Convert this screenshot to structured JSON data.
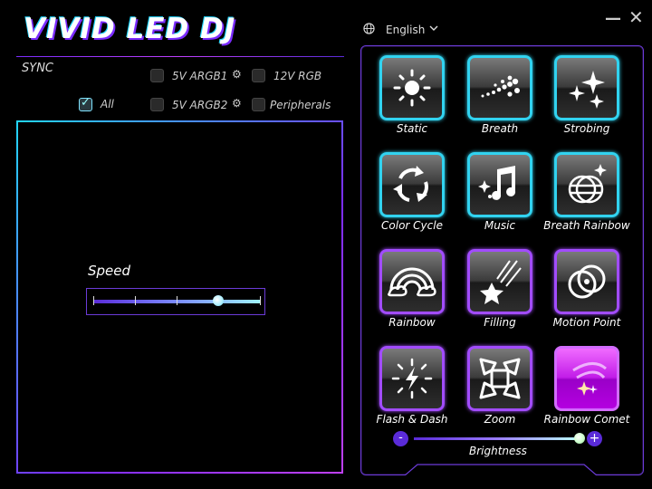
{
  "app": {
    "title": "VIVID LED DJ"
  },
  "window": {
    "minimize_glyph": "—",
    "close_glyph": "✕"
  },
  "language": {
    "selected": "English",
    "icon": "globe-icon"
  },
  "sync": {
    "label": "SYNC",
    "options": [
      {
        "label": "All",
        "checked": true
      },
      {
        "label": "5V ARGB1",
        "checked": false,
        "icon": "gear-icon"
      },
      {
        "label": "12V RGB",
        "checked": false
      },
      {
        "label": "5V ARGB2",
        "checked": false,
        "icon": "gear-icon"
      },
      {
        "label": "Peripherals",
        "checked": false
      }
    ]
  },
  "speed": {
    "label": "Speed",
    "value_fraction": 0.75,
    "steps": 5
  },
  "effects": [
    {
      "label": "Static",
      "icon": "sun-icon",
      "variant": "cyan"
    },
    {
      "label": "Breath",
      "icon": "dots-breath-icon",
      "variant": "cyan"
    },
    {
      "label": "Strobing",
      "icon": "sparkles-icon",
      "variant": "cyan"
    },
    {
      "label": "Color Cycle",
      "icon": "cycle-arrows-icon",
      "variant": "cyan"
    },
    {
      "label": "Music",
      "icon": "music-note-icon",
      "variant": "cyan"
    },
    {
      "label": "Breath Rainbow",
      "icon": "breath-rainbow-icon",
      "variant": "cyan"
    },
    {
      "label": "Rainbow",
      "icon": "rainbow-icon",
      "variant": "purple"
    },
    {
      "label": "Filling",
      "icon": "falling-star-icon",
      "variant": "purple"
    },
    {
      "label": "Motion Point",
      "icon": "motion-point-icon",
      "variant": "purple"
    },
    {
      "label": "Flash & Dash",
      "icon": "flash-icon",
      "variant": "purple"
    },
    {
      "label": "Zoom",
      "icon": "zoom-arrows-icon",
      "variant": "purple"
    },
    {
      "label": "Rainbow Comet",
      "icon": "comet-icon",
      "variant": "active"
    }
  ],
  "brightness": {
    "label": "Brightness",
    "minus": "-",
    "plus": "+",
    "value_fraction": 0.96
  },
  "colors": {
    "accent_cyan": "#31d3f0",
    "accent_purple": "#a24cff",
    "active_magenta": "#c21de8"
  }
}
